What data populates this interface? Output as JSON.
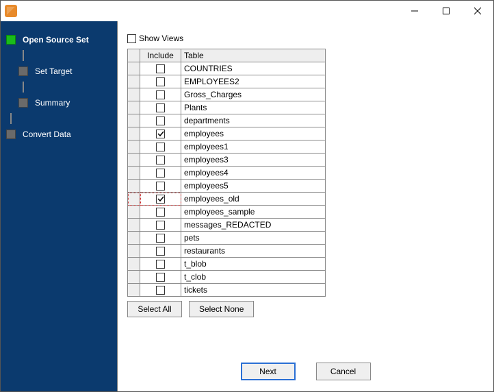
{
  "sidebar": {
    "steps": [
      {
        "label": "Open Source Set",
        "active": true,
        "indent": 0
      },
      {
        "label": "Set Target",
        "active": false,
        "indent": 1
      },
      {
        "label": "Summary",
        "active": false,
        "indent": 1
      },
      {
        "label": "Convert Data",
        "active": false,
        "indent": 0
      }
    ]
  },
  "main": {
    "show_views_label": "Show Views",
    "show_views_checked": false,
    "columns": {
      "include": "Include",
      "table": "Table"
    },
    "rows": [
      {
        "include": false,
        "table": "COUNTRIES",
        "focus": false
      },
      {
        "include": false,
        "table": "EMPLOYEES2",
        "focus": false
      },
      {
        "include": false,
        "table": "Gross_Charges",
        "focus": false
      },
      {
        "include": false,
        "table": "Plants",
        "focus": false
      },
      {
        "include": false,
        "table": "departments",
        "focus": false
      },
      {
        "include": true,
        "table": "employees",
        "focus": false
      },
      {
        "include": false,
        "table": "employees1",
        "focus": false
      },
      {
        "include": false,
        "table": "employees3",
        "focus": false
      },
      {
        "include": false,
        "table": "employees4",
        "focus": false
      },
      {
        "include": false,
        "table": "employees5",
        "focus": false
      },
      {
        "include": true,
        "table": "employees_old",
        "focus": true
      },
      {
        "include": false,
        "table": "employees_sample",
        "focus": false
      },
      {
        "include": false,
        "table": "messages_REDACTED",
        "focus": false
      },
      {
        "include": false,
        "table": "pets",
        "focus": false
      },
      {
        "include": false,
        "table": "restaurants",
        "focus": false
      },
      {
        "include": false,
        "table": "t_blob",
        "focus": false
      },
      {
        "include": false,
        "table": "t_clob",
        "focus": false
      },
      {
        "include": false,
        "table": "tickets",
        "focus": false
      }
    ],
    "select_all_label": "Select All",
    "select_none_label": "Select None",
    "next_label": "Next",
    "cancel_label": "Cancel"
  }
}
